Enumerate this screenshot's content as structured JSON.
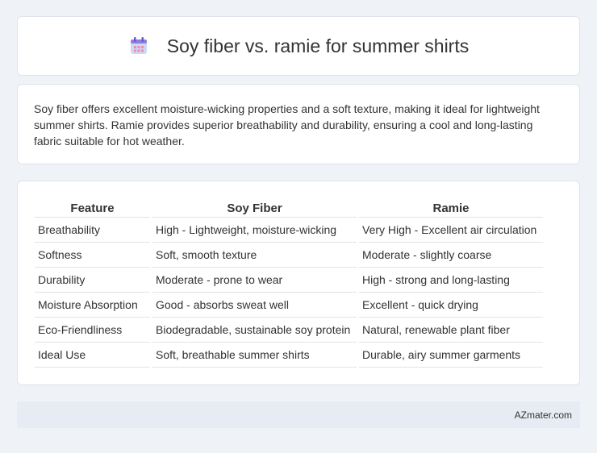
{
  "header": {
    "title": "Soy fiber vs. ramie for summer shirts",
    "icon": "calendar-icon"
  },
  "description": {
    "text": "Soy fiber offers excellent moisture-wicking properties and a soft texture, making it ideal for lightweight summer shirts. Ramie provides superior breathability and durability, ensuring a cool and long-lasting fabric suitable for hot weather."
  },
  "table": {
    "headers": [
      "Feature",
      "Soy Fiber",
      "Ramie"
    ],
    "rows": [
      [
        "Breathability",
        "High - Lightweight, moisture-wicking",
        "Very High - Excellent air circulation"
      ],
      [
        "Softness",
        "Soft, smooth texture",
        "Moderate - slightly coarse"
      ],
      [
        "Durability",
        "Moderate - prone to wear",
        "High - strong and long-lasting"
      ],
      [
        "Moisture Absorption",
        "Good - absorbs sweat well",
        "Excellent - quick drying"
      ],
      [
        "Eco-Friendliness",
        "Biodegradable, sustainable soy protein",
        "Natural, renewable plant fiber"
      ],
      [
        "Ideal Use",
        "Soft, breathable summer shirts",
        "Durable, airy summer garments"
      ]
    ]
  },
  "footer": {
    "brand": "AZmater.com"
  },
  "colors": {
    "background": "#eff2f7",
    "card": "#ffffff",
    "footer": "#e6ebf4",
    "icon_accent": "#8e7ee0"
  }
}
